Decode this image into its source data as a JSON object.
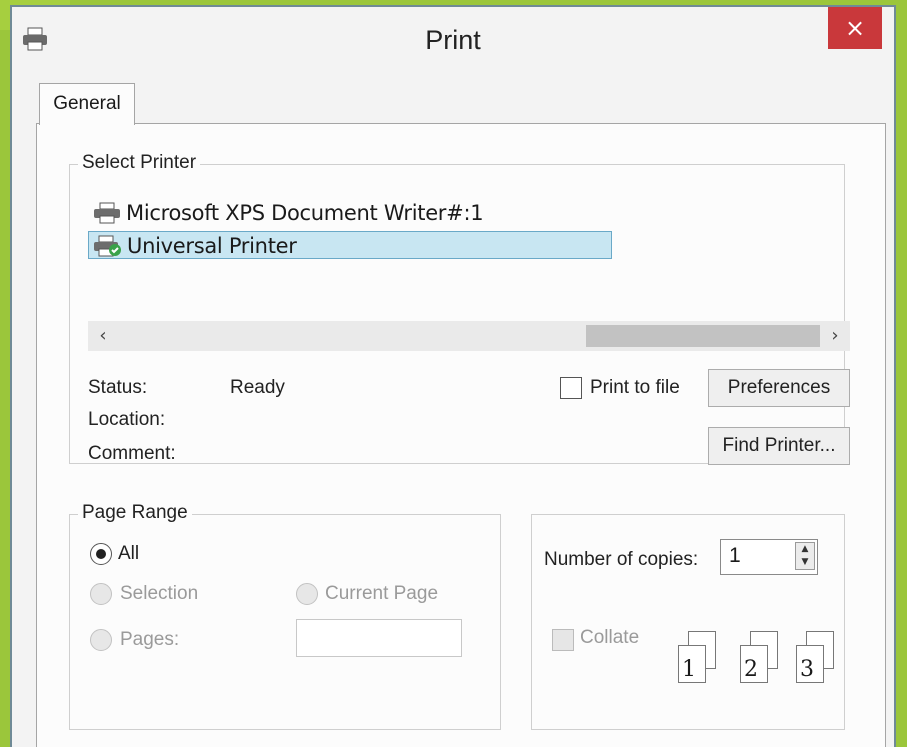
{
  "window": {
    "title": "Print",
    "close_glyph": "×"
  },
  "tabs": [
    {
      "label": "General"
    }
  ],
  "select_printer": {
    "legend": "Select Printer",
    "printers": [
      {
        "name": "Microsoft XPS Document Writer#:1",
        "icon": "printer-icon",
        "selected": false
      },
      {
        "name": "Universal Printer",
        "icon": "printer-check-icon",
        "selected": true
      }
    ],
    "scroll_left": "‹",
    "scroll_right": "›",
    "status_label": "Status:",
    "status_value": "Ready",
    "location_label": "Location:",
    "comment_label": "Comment:",
    "print_to_file_label": "Print to file",
    "print_to_file_checked": false,
    "preferences_label": "Preferences",
    "find_printer_label": "Find Printer..."
  },
  "page_range": {
    "legend": "Page Range",
    "all_label": "All",
    "selection_label": "Selection",
    "current_page_label": "Current Page",
    "pages_label": "Pages:",
    "selected": "All",
    "pages_value": ""
  },
  "copies": {
    "number_label": "Number of copies:",
    "number_value": "1",
    "collate_label": "Collate",
    "collate_checked": false,
    "collate_pages": [
      "1",
      "1",
      "2",
      "2",
      "3",
      "3"
    ]
  },
  "colors": {
    "accent_green": "#9bc63b",
    "close_red": "#c9383b",
    "selection_blue": "#c8e6f2"
  }
}
